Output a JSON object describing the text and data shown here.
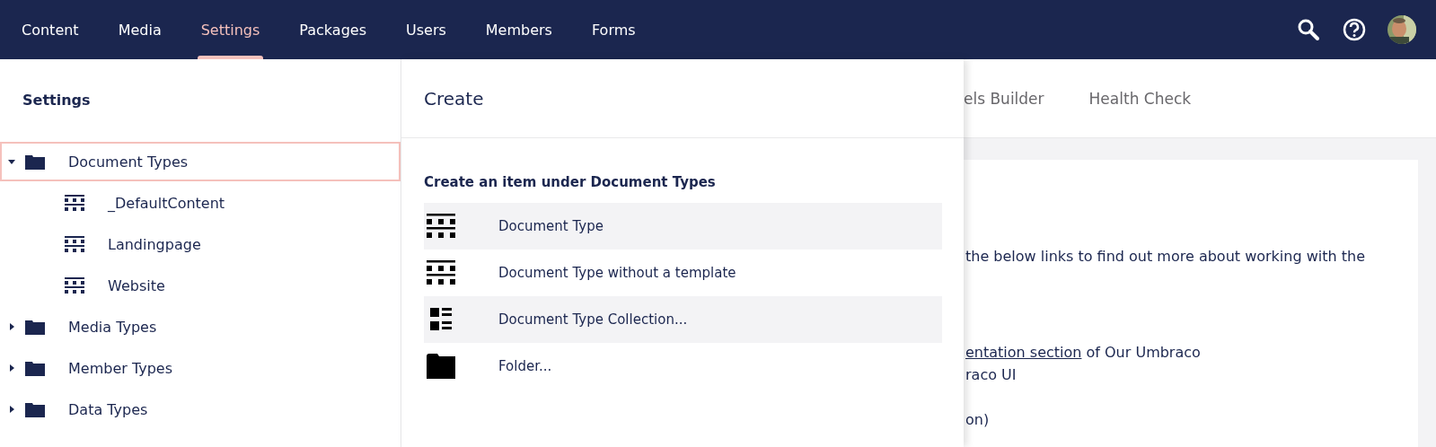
{
  "top_nav": {
    "items": [
      {
        "label": "Content",
        "selected": false
      },
      {
        "label": "Media",
        "selected": false
      },
      {
        "label": "Settings",
        "selected": true
      },
      {
        "label": "Packages",
        "selected": false
      },
      {
        "label": "Users",
        "selected": false
      },
      {
        "label": "Members",
        "selected": false
      },
      {
        "label": "Forms",
        "selected": false
      }
    ]
  },
  "sidebar": {
    "title": "Settings",
    "tree": [
      {
        "label": "Document Types",
        "kind": "folder",
        "expanded": true,
        "selected": true,
        "children": [
          {
            "label": "_DefaultContent",
            "kind": "doctype",
            "selected": false
          },
          {
            "label": "Landingpage",
            "kind": "doctype",
            "selected": false
          },
          {
            "label": "Website",
            "kind": "doctype",
            "selected": false
          }
        ]
      },
      {
        "label": "Media Types",
        "kind": "folder",
        "expanded": false,
        "selected": false
      },
      {
        "label": "Member Types",
        "kind": "folder",
        "expanded": false,
        "selected": false
      },
      {
        "label": "Data Types",
        "kind": "folder",
        "expanded": false,
        "selected": false
      }
    ]
  },
  "create_panel": {
    "title": "Create",
    "subtitle": "Create an item under Document Types",
    "items": [
      {
        "label": "Document Type",
        "kind": "doctype",
        "highlighted": true
      },
      {
        "label": "Document Type without a template",
        "kind": "doctype",
        "highlighted": false
      },
      {
        "label": "Document Type Collection...",
        "kind": "collection",
        "highlighted": true
      },
      {
        "label": "Folder...",
        "kind": "folder",
        "highlighted": false
      }
    ]
  },
  "content": {
    "tabs": [
      "els Builder",
      "Health Check"
    ],
    "lines": [
      {
        "parts": [
          {
            "text": "the below links to find out more about working with the",
            "link": false
          }
        ]
      },
      {
        "parts": [
          {
            "text": "entation section",
            "link": true
          },
          {
            "text": " of Our Umbraco",
            "link": false
          }
        ]
      },
      {
        "parts": [
          {
            "text": "raco UI",
            "link": false
          }
        ]
      },
      {
        "parts": [
          {
            "text": "on)",
            "link": false
          }
        ]
      }
    ]
  }
}
